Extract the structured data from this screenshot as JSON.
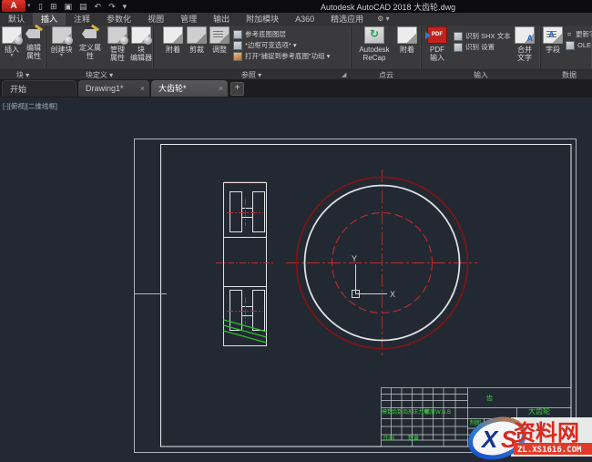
{
  "window": {
    "title": "Autodesk AutoCAD 2018   大齿轮.dwg",
    "logo_letter": "A"
  },
  "quick_access": {
    "icons": [
      {
        "name": "new-file-icon",
        "glyph": "▯"
      },
      {
        "name": "open-file-icon",
        "glyph": "⊞"
      },
      {
        "name": "save-icon",
        "glyph": "▣"
      },
      {
        "name": "plot-icon",
        "glyph": "▤"
      },
      {
        "name": "undo-icon",
        "glyph": "↶"
      },
      {
        "name": "redo-icon",
        "glyph": "↷"
      },
      {
        "name": "qat-dropdown-icon",
        "glyph": "▾"
      }
    ]
  },
  "menu": {
    "tabs": [
      "默认",
      "插入",
      "注释",
      "参数化",
      "视图",
      "管理",
      "输出",
      "附加模块",
      "A360",
      "精选应用"
    ],
    "active": "插入",
    "workspace_glyph": "⚙ ▾"
  },
  "ribbon": {
    "panels": [
      {
        "label": "块 ▾"
      },
      {
        "label": "块定义 ▾"
      },
      {
        "label": "参照 ▾"
      },
      {
        "label": "点云"
      },
      {
        "label": "输入"
      },
      {
        "label": "数据"
      }
    ],
    "launcher_glyph": "◢",
    "buttons": {
      "insert": {
        "l1": "插入",
        "arrow": "▾"
      },
      "edit_attr": {
        "l1": "编辑",
        "l2": "属性",
        "arrow": "▾"
      },
      "create_block": {
        "l1": "创建块",
        "arrow": "▾"
      },
      "define_attr": {
        "l1": "定义属性"
      },
      "manage_attr": {
        "l1": "管理",
        "l2": "属性"
      },
      "block_editor": {
        "l1": "块",
        "l2": "编辑器"
      },
      "attach": {
        "l1": "附着"
      },
      "clip": {
        "l1": "剪裁"
      },
      "adjust": {
        "l1": "调整"
      },
      "recap": {
        "l1": "Autodesk",
        "l2": "ReCap",
        "icon_glyph": "↻"
      },
      "pc_attach": {
        "l1": "附着"
      },
      "pdf_import": {
        "l1": "PDF",
        "l2": "输入",
        "arrow": "▾",
        "icon_text": "PDF"
      },
      "merge_text": {
        "l1": "合并",
        "l2": "文字"
      },
      "field": {
        "l1": "字段"
      }
    },
    "rows": {
      "ref_layers": "参考底图图层",
      "frame_option": "*边框可变选项*  ▾",
      "snap_group": "打开“捕捉到参考底图”功组 ▾",
      "shx_text": "识别 SHX 文本",
      "shx_settings": "识别 设置",
      "eq_glyph": "=",
      "update_field": "更新字段",
      "ole": "OLE 对象"
    }
  },
  "file_tabs": {
    "tabs": [
      {
        "label": "开始",
        "close": ""
      },
      {
        "label": "Drawing1*",
        "close": "×"
      },
      {
        "label": "大齿轮*",
        "close": "×"
      }
    ],
    "new_tab_glyph": "+"
  },
  "viewport": {
    "controls": "[-][俯视][二维线框]"
  },
  "ucs": {
    "x_label": "X",
    "y_label": "Y"
  },
  "title_block": {
    "part_name": "大齿轮",
    "cell_note": "齿",
    "params": [
      "模数",
      "齿数",
      "齿形",
      "压力角",
      "精度",
      "W.N.B"
    ],
    "signs": [
      "制图",
      "校对",
      "审核"
    ],
    "extras": [
      "比例",
      "数量"
    ]
  },
  "watermark": {
    "initials_x": "X",
    "initials_s": "S",
    "name": "资料网",
    "domain": "ZL.XS1616.COM"
  },
  "colors": {
    "centerline_red": "#bf2b2b",
    "outer_circle_red": "#7d1517",
    "hatch_green": "#2ec32e",
    "table_green": "#3ad13d",
    "watermark_red": "#d8281e"
  }
}
